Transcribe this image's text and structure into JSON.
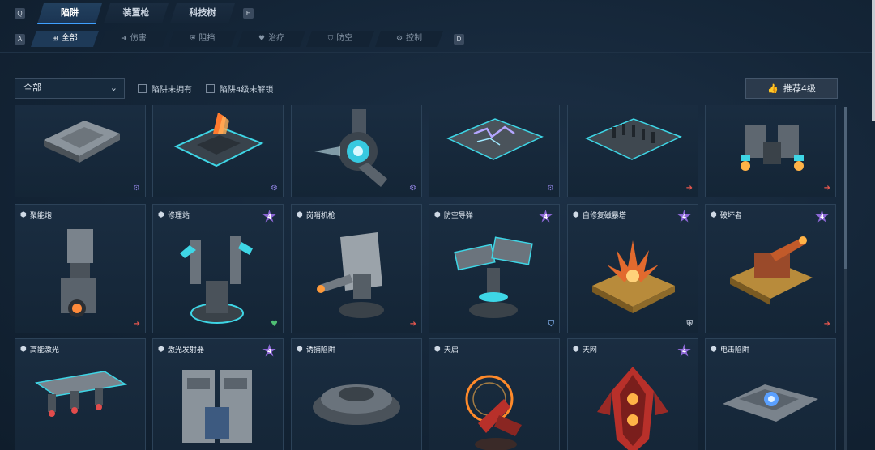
{
  "hotkeys": {
    "prev_top": "Q",
    "next_top": "E",
    "prev_sub": "A",
    "next_sub": "D"
  },
  "top_tabs": [
    {
      "label": "陷阱",
      "active": true
    },
    {
      "label": "装置枪",
      "active": false
    },
    {
      "label": "科技树",
      "active": false
    }
  ],
  "sub_tabs": [
    {
      "label": "全部",
      "icon": "grid-icon",
      "glyph": "⊞",
      "active": true
    },
    {
      "label": "伤害",
      "icon": "arrow-damage-icon",
      "glyph": "➜",
      "active": false
    },
    {
      "label": "阻挡",
      "icon": "shield-block-icon",
      "glyph": "⛨",
      "active": false
    },
    {
      "label": "治疗",
      "icon": "heal-heart-icon",
      "glyph": "♥",
      "active": false
    },
    {
      "label": "防空",
      "icon": "anti-air-shield-icon",
      "glyph": "⛉",
      "active": false
    },
    {
      "label": "控制",
      "icon": "gear-control-icon",
      "glyph": "⚙",
      "active": false
    }
  ],
  "filter": {
    "dropdown_value": "全部",
    "checkbox_not_owned": "陷阱未拥有",
    "checkbox_lv4_locked": "陷阱4级未解锁",
    "recommend_label": "推荐4级"
  },
  "colors": {
    "accent": "#3fa0ff",
    "damage": "#e0564e",
    "heal": "#4fbf74",
    "control": "#8a7fd9",
    "star": "#8d68d6"
  },
  "cards": [
    {
      "name": "",
      "star": false,
      "role": "control",
      "glyph": "⚙",
      "model": "plate"
    },
    {
      "name": "",
      "star": false,
      "role": "control",
      "glyph": "⚙",
      "model": "fireplate"
    },
    {
      "name": "",
      "star": false,
      "role": "control",
      "glyph": "⚙",
      "model": "turbine"
    },
    {
      "name": "",
      "star": false,
      "role": "control",
      "glyph": "⚙",
      "model": "shock"
    },
    {
      "name": "",
      "star": false,
      "role": "damage",
      "glyph": "➜",
      "model": "spikes"
    },
    {
      "name": "",
      "star": false,
      "role": "damage",
      "glyph": "➜",
      "model": "drone"
    },
    {
      "name": "聚能炮",
      "star": false,
      "role": "damage",
      "glyph": "➜",
      "model": "cannon"
    },
    {
      "name": "修理站",
      "star": true,
      "star_text": "4",
      "role": "heal",
      "glyph": "♥",
      "model": "repair"
    },
    {
      "name": "岗哨机枪",
      "star": false,
      "role": "damage",
      "glyph": "➜",
      "model": "sentry"
    },
    {
      "name": "防空导弹",
      "star": true,
      "star_text": "4",
      "role": "antiair",
      "glyph": "⛉",
      "model": "missile"
    },
    {
      "name": "自修复磁暴塔",
      "star": true,
      "star_text": "4",
      "role": "block",
      "glyph": "⛨",
      "model": "tesla"
    },
    {
      "name": "破坏者",
      "star": true,
      "star_text": "4",
      "role": "damage",
      "glyph": "➜",
      "model": "breaker"
    },
    {
      "name": "高能激光",
      "star": false,
      "role": "",
      "glyph": "",
      "model": "laser"
    },
    {
      "name": "激光发射器",
      "star": true,
      "star_text": "4",
      "role": "",
      "glyph": "",
      "model": "emitter"
    },
    {
      "name": "诱捕陷阱",
      "star": false,
      "role": "",
      "glyph": "",
      "model": "lure"
    },
    {
      "name": "天启",
      "star": false,
      "role": "",
      "glyph": "",
      "model": "apoc"
    },
    {
      "name": "天网",
      "star": true,
      "star_text": "4",
      "role": "",
      "glyph": "",
      "model": "skynet"
    },
    {
      "name": "电击陷阱",
      "star": false,
      "role": "",
      "glyph": "",
      "model": "electric"
    }
  ]
}
